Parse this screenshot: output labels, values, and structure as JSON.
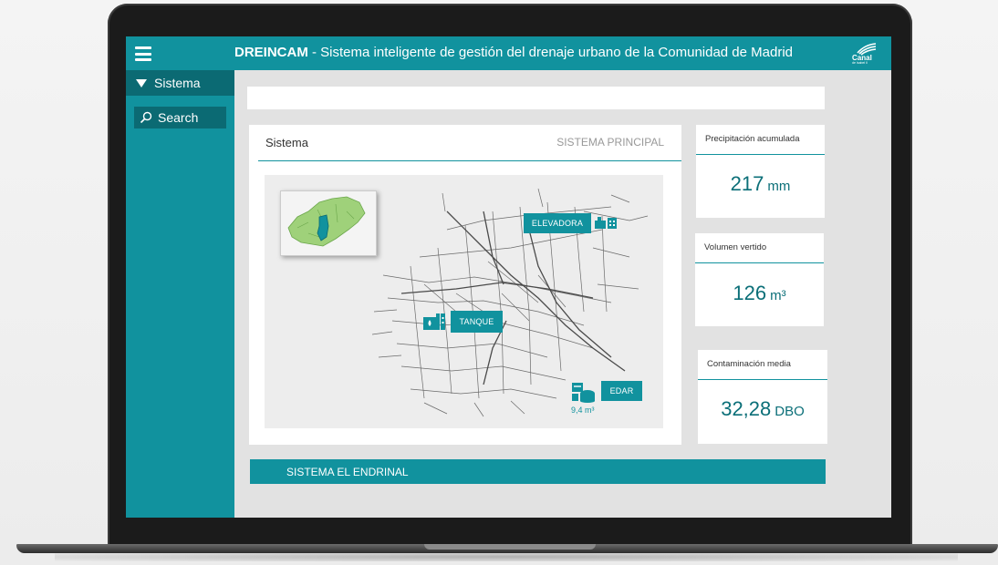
{
  "header": {
    "title_bold": "DREINCAM",
    "title_rest": " - Sistema inteligente de gestión del drenaje urbano de la Comunidad de Madrid",
    "logo_text": "Canal",
    "logo_subtext": "de Isabel II"
  },
  "sidebar": {
    "section_label": "Sistema",
    "search_label": "Search"
  },
  "panel": {
    "title": "Sistema",
    "subtitle": "SISTEMA PRINCIPAL",
    "map": {
      "labels": {
        "elevadora": "ELEVADORA",
        "tanque": "TANQUE",
        "edar": "EDAR"
      },
      "edar_volume": "9,4 m³"
    }
  },
  "kpis": [
    {
      "label": "Precipitación acumulada",
      "value": "217",
      "unit": "mm"
    },
    {
      "label": "Volumen vertido",
      "value": "126",
      "unit": "m³"
    },
    {
      "label": "Contaminación media",
      "value": "32,28",
      "unit": "DBO"
    }
  ],
  "bottom_bar": {
    "label": "SISTEMA EL ENDRINAL"
  },
  "colors": {
    "accent": "#11929e",
    "accent_dark": "#0b6a73",
    "value_text": "#0b6f78"
  },
  "icons": [
    "menu-icon",
    "triangle-down-icon",
    "search-icon",
    "tank-icon",
    "pump-station-icon",
    "treatment-plant-icon",
    "canal-logo"
  ]
}
